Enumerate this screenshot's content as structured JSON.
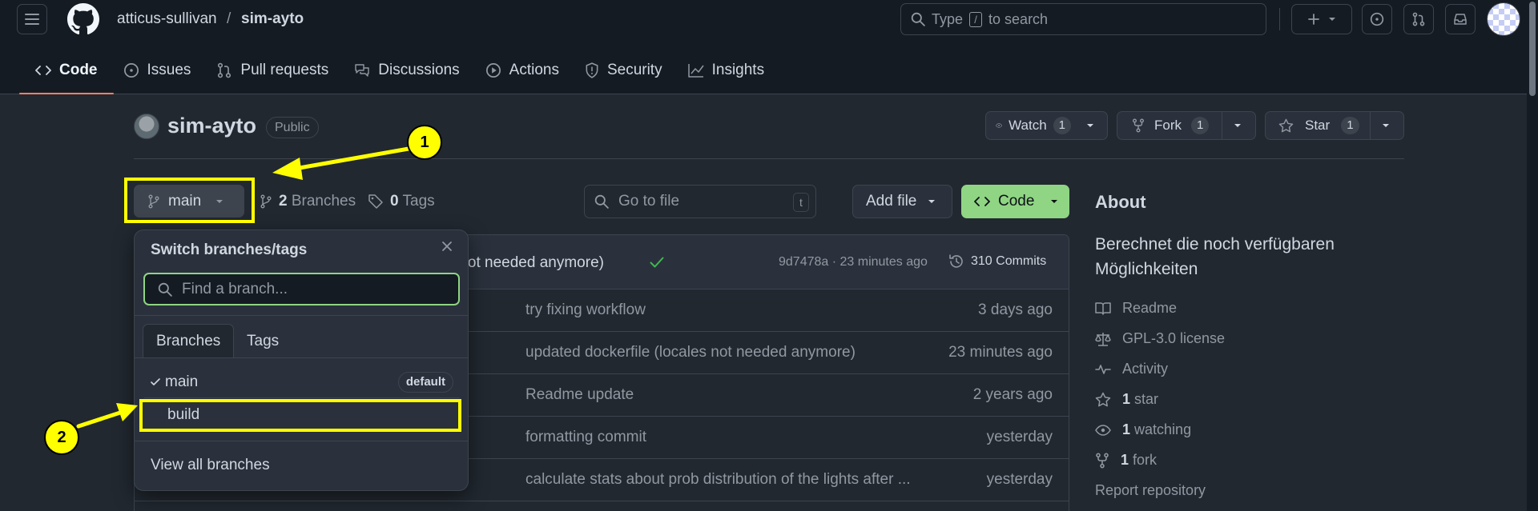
{
  "header": {
    "owner": "atticus-sullivan",
    "separator": "/",
    "repo": "sim-ayto",
    "search_prefix": "Type",
    "search_key": "/",
    "search_suffix": "to search"
  },
  "nav": {
    "code": "Code",
    "issues": "Issues",
    "pulls": "Pull requests",
    "discussions": "Discussions",
    "actions": "Actions",
    "security": "Security",
    "insights": "Insights"
  },
  "repo": {
    "name": "sim-ayto",
    "visibility": "Public",
    "watch_label": "Watch",
    "watch_count": "1",
    "fork_label": "Fork",
    "fork_count": "1",
    "star_label": "Star",
    "star_count": "1"
  },
  "toolbar": {
    "branch": "main",
    "branches_count": "2",
    "branches_label": "Branches",
    "tags_count": "0",
    "tags_label": "Tags",
    "goto_placeholder": "Go to file",
    "goto_key": "t",
    "addfile_label": "Add file",
    "code_label": "Code"
  },
  "commit": {
    "message_fragment": "es not needed anymore)",
    "hash_time": "9d7478a · 23 minutes ago",
    "commits_label": "310 Commits"
  },
  "files": [
    {
      "message": "try fixing workflow",
      "when": "3 days ago"
    },
    {
      "message": "updated dockerfile (locales not needed anymore)",
      "when": "23 minutes ago"
    },
    {
      "message": "Readme update",
      "when": "2 years ago"
    },
    {
      "message": "formatting commit",
      "when": "yesterday"
    },
    {
      "message": "calculate stats about prob distribution of the lights after ...",
      "when": "yesterday"
    }
  ],
  "about": {
    "title": "About",
    "description": "Berechnet die noch verfügbaren Möglichkeiten",
    "readme": "Readme",
    "license": "GPL-3.0 license",
    "activity": "Activity",
    "stars_count": "1",
    "stars_label": "star",
    "watching_count": "1",
    "watching_label": "watching",
    "forks_count": "1",
    "forks_label": "fork",
    "report": "Report repository"
  },
  "dropdown": {
    "title": "Switch branches/tags",
    "find_placeholder": "Find a branch...",
    "tab_branches": "Branches",
    "tab_tags": "Tags",
    "branches": [
      {
        "name": "main",
        "badge": "default"
      },
      {
        "name": "build"
      }
    ],
    "view_all": "View all branches"
  },
  "annotations": {
    "callout_1": "1",
    "callout_2": "2",
    "highlight_color": "#ffff00"
  }
}
